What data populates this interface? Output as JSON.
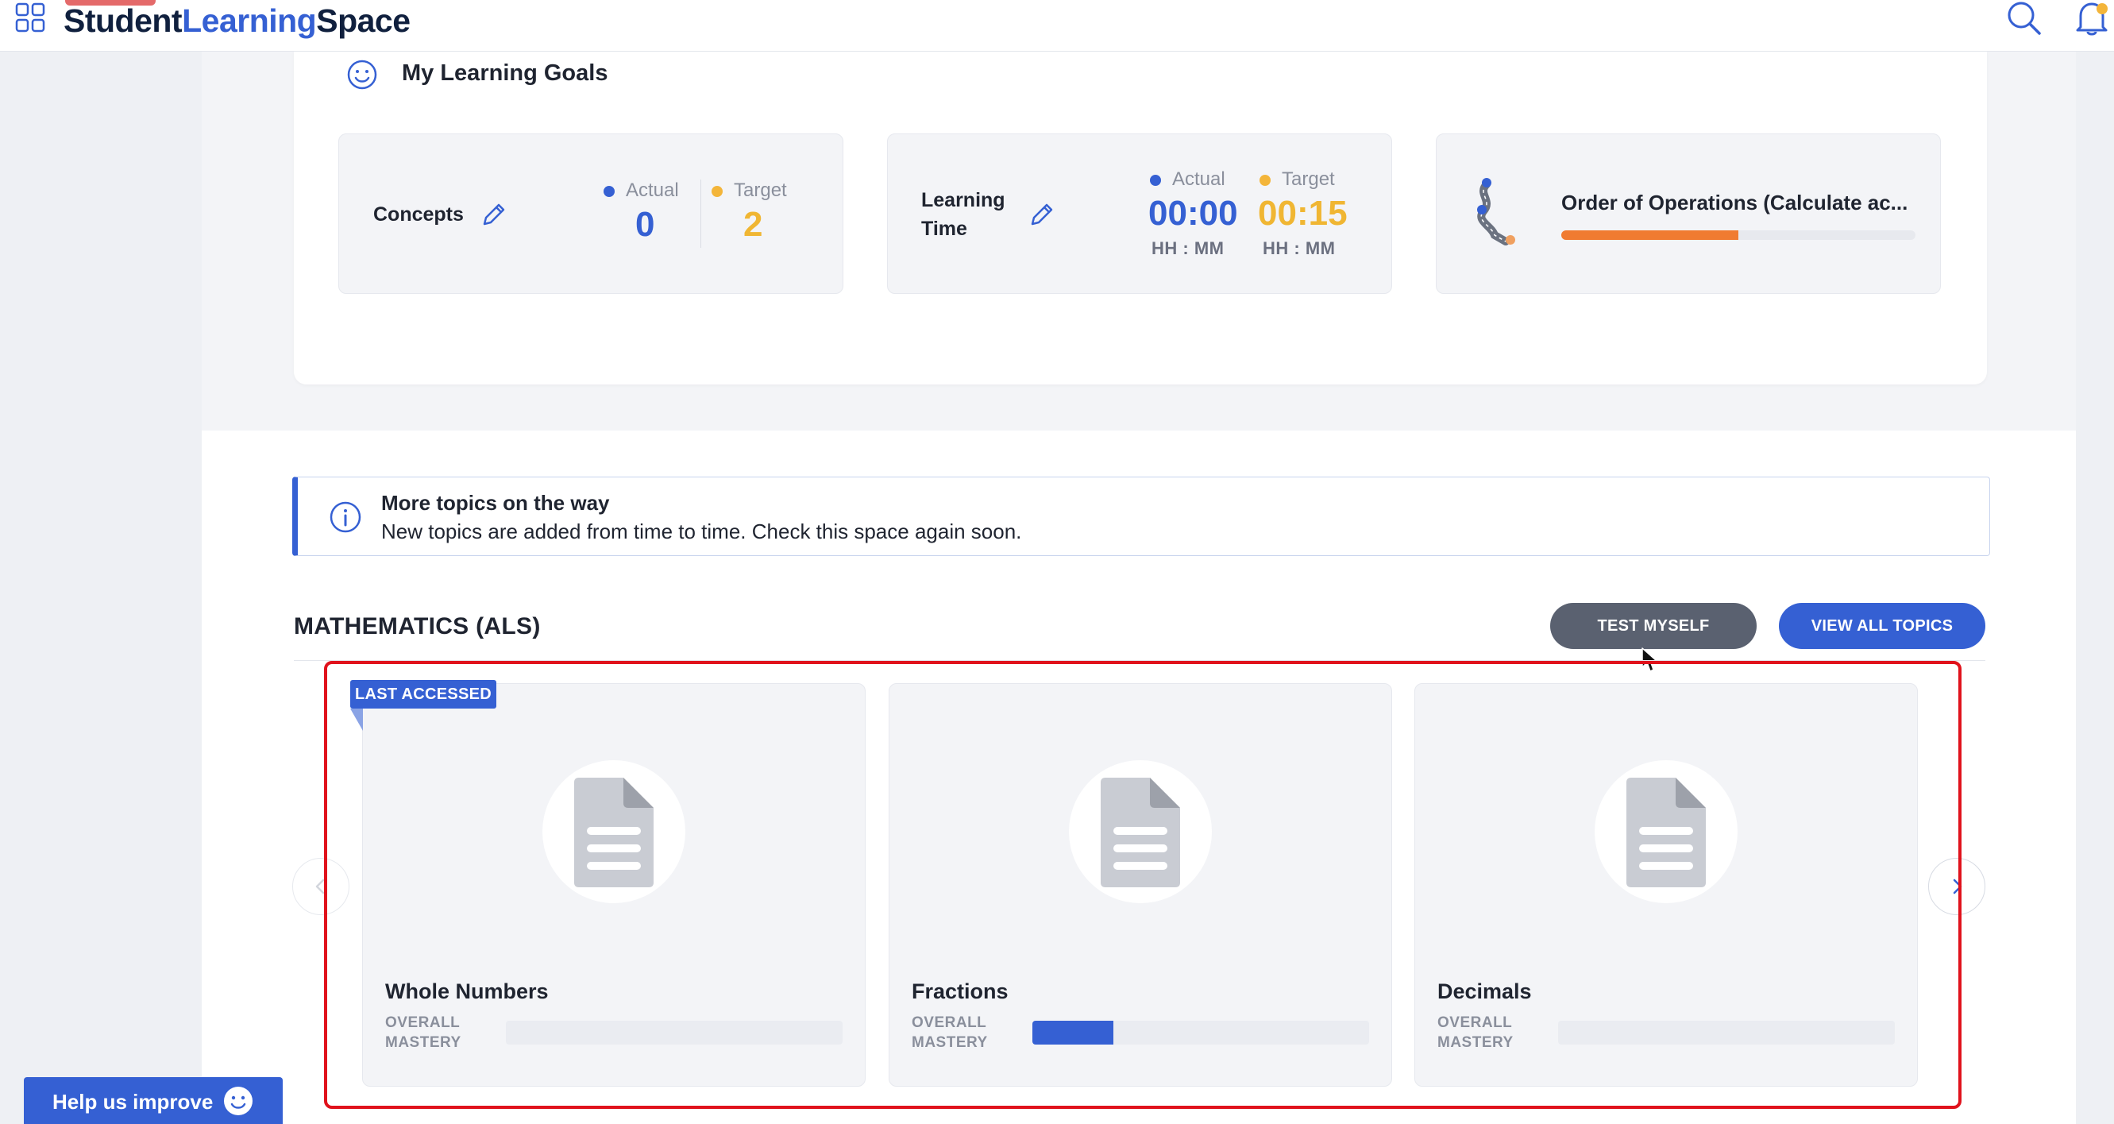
{
  "header": {
    "brand_part1": "Student",
    "brand_part2": "Learning",
    "brand_part3": "Space",
    "icons": [
      "apps-grid-icon",
      "search-icon",
      "bell-icon"
    ]
  },
  "goals": {
    "title": "My Learning Goals",
    "concepts": {
      "label": "Concepts",
      "actual_label": "Actual",
      "target_label": "Target",
      "actual_value": "0",
      "target_value": "2"
    },
    "learning_time": {
      "label_line1": "Learning",
      "label_line2": "Time",
      "actual_label": "Actual",
      "target_label": "Target",
      "actual_value": "00:00",
      "target_value": "00:15",
      "actual_unit": "HH : MM",
      "target_unit": "HH : MM"
    },
    "current_topic": {
      "title": "Order of Operations (Calculate ac...",
      "progress_percent": 50,
      "progress_color": "#f07b31"
    }
  },
  "info_banner": {
    "title": "More topics on the way",
    "text": "New topics are added from time to time. Check this space again soon."
  },
  "subject": {
    "title": "MATHEMATICS (ALS)",
    "test_button": "TEST MYSELF",
    "view_all_button": "VIEW ALL TOPICS"
  },
  "topics": {
    "badge": "LAST ACCESSED",
    "mastery_line1": "OVERALL",
    "mastery_line2": "MASTERY",
    "items": [
      {
        "name": "Whole Numbers",
        "mastery_percent": 0
      },
      {
        "name": "Fractions",
        "mastery_percent": 24
      },
      {
        "name": "Decimals",
        "mastery_percent": 0
      }
    ]
  },
  "help": {
    "label": "Help us improve"
  },
  "colors": {
    "accent": "#3560d3",
    "target": "#f0b633",
    "highlight": "#e0121c"
  }
}
